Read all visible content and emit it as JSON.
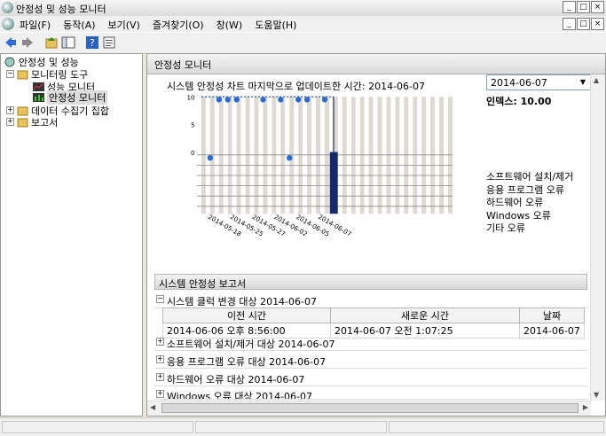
{
  "window": {
    "title": "안정성 및 성능 모니터"
  },
  "menu": [
    "파일(F)",
    "동작(A)",
    "보기(V)",
    "즐겨찾기(O)",
    "창(W)",
    "도움말(H)"
  ],
  "tree": {
    "root": "안정성 및 성능",
    "monitoring_tools": "모니터링 도구",
    "perf_monitor": "성능 모니터",
    "reliability_monitor": "안정성 모니터",
    "data_collector_sets": "데이터 수집기 집합",
    "reports": "보고서"
  },
  "panel": {
    "title": "안정성 모니터",
    "last_updated": "시스템 안정성 차트 마지막으로 업데이트한 시간: 2014-06-07",
    "date_select": "2014-06-07",
    "index_label": "인덱스: 10.00"
  },
  "chart_data": {
    "type": "line",
    "ylim": [
      0,
      10
    ],
    "y_ticks": [
      "10",
      "5",
      "0"
    ],
    "x_tick_labels": [
      "2014-05-18",
      "2014-05-25",
      "2014-05-27",
      "2014-06-02",
      "2014-06-05",
      "2014-06-07"
    ],
    "series": [
      {
        "values": [
          10,
          10,
          10,
          10,
          10,
          10,
          10,
          10,
          10,
          10,
          10,
          10,
          10,
          10,
          10,
          10
        ]
      }
    ],
    "selected_day_index": 15,
    "info_marker_columns": [
      2,
      3,
      4,
      7,
      9,
      11,
      12,
      14
    ],
    "install_info_columns": [
      1,
      10
    ],
    "rows": [
      "소프트웨어 설치/제거",
      "응용 프로그램 오류",
      "하드웨어 오류",
      "Windows 오류",
      "기타 오류"
    ]
  },
  "report": {
    "title": "시스템 안정성 보고서",
    "groups": [
      {
        "label": "시스템 클럭 변경 대상 2014-06-07",
        "expanded": true
      },
      {
        "label": "소프트웨어 설치/제거 대상 2014-06-07",
        "expanded": false
      },
      {
        "label": "응용 프로그램 오류 대상 2014-06-07",
        "expanded": false
      },
      {
        "label": "하드웨어 오류 대상 2014-06-07",
        "expanded": false
      },
      {
        "label": "Windows 오류 대상 2014-06-07",
        "expanded": false
      }
    ],
    "columns": [
      "이전 시간",
      "새로운 시간",
      "날짜"
    ],
    "rows": [
      [
        "2014-06-06 오후 8:56:00",
        "2014-06-07 오전 1:07:25",
        "2014-06-07"
      ]
    ]
  }
}
